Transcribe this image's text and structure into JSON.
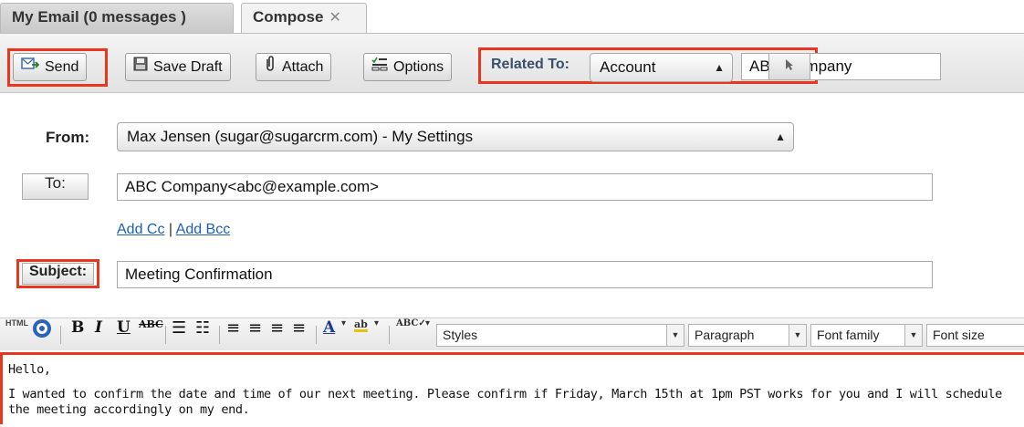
{
  "tabs": [
    {
      "label": "My Email (0 messages )"
    },
    {
      "label": "Compose",
      "close": "✕"
    }
  ],
  "toolbar": {
    "send_label": "Send",
    "save_draft_label": "Save Draft",
    "attach_label": "Attach",
    "options_label": "Options",
    "related_to_label": "Related To:",
    "related_type": "Account",
    "related_name": "ABC Company"
  },
  "form": {
    "from_label": "From:",
    "from_value": "Max Jensen (sugar@sugarcrm.com) - My Settings",
    "to_label": "To:",
    "to_value": "ABC Company<abc@example.com>",
    "add_cc": "Add Cc",
    "add_sep": "|",
    "add_bcc": "Add Bcc",
    "subject_label": "Subject:",
    "subject_value": "Meeting Confirmation"
  },
  "editor": {
    "html_label": "HTML",
    "styles": "Styles",
    "paragraph": "Paragraph",
    "font_family": "Font family",
    "font_size": "Font size"
  },
  "body": {
    "greeting": "Hello,",
    "text": "I wanted to confirm the date and time of our next meeting. Please confirm if Friday, March 15th at 1pm PST works for you and I will schedule the meeting accordingly on my end."
  },
  "colors": {
    "highlight": "#e8361f",
    "link": "#1f5fb3",
    "related_label": "#3a4f6b"
  }
}
